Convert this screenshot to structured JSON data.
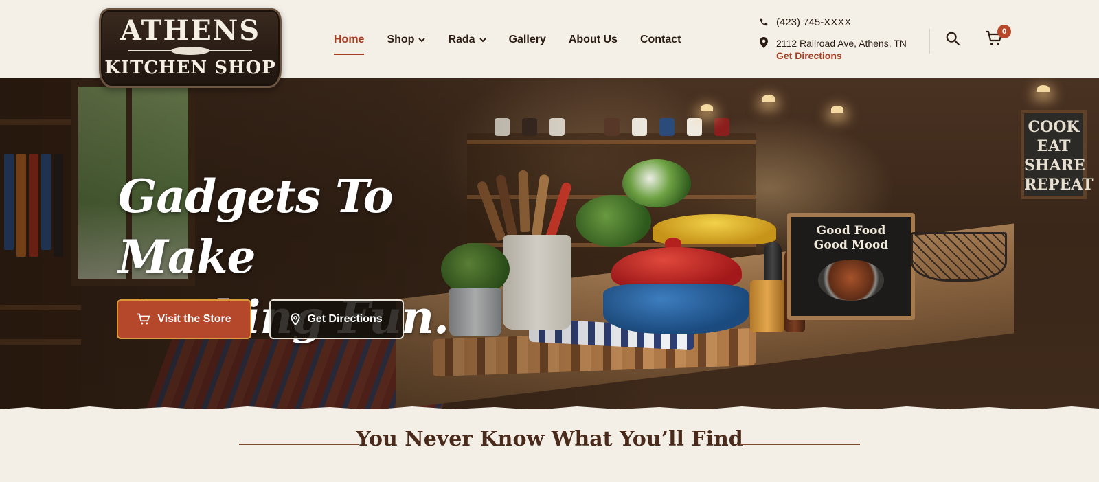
{
  "logo": {
    "line1": "ATHENS",
    "line2": "KITCHEN SHOP"
  },
  "nav": {
    "items": [
      {
        "label": "Home",
        "active": true,
        "has_dropdown": false
      },
      {
        "label": "Shop",
        "active": false,
        "has_dropdown": true
      },
      {
        "label": "Rada",
        "active": false,
        "has_dropdown": true
      },
      {
        "label": "Gallery",
        "active": false,
        "has_dropdown": false
      },
      {
        "label": "About Us",
        "active": false,
        "has_dropdown": false
      },
      {
        "label": "Contact",
        "active": false,
        "has_dropdown": false
      }
    ]
  },
  "contact": {
    "phone": "(423) 745-XXXX",
    "address": "2112 Railroad Ave, Athens, TN",
    "directions_link": "Get Directions"
  },
  "cart": {
    "count": "0"
  },
  "hero": {
    "title_line1": "Gadgets To Make",
    "title_line2": "Cooking Fun.",
    "primary_button": "Visit the Store",
    "secondary_button": "Get Directions",
    "sign_text": [
      "COOK",
      "EAT",
      "SHARE",
      "REPEAT"
    ],
    "book_title": [
      "Good Food",
      "Good Mood"
    ]
  },
  "section": {
    "title": "You Never Know What You’ll Find"
  },
  "colors": {
    "accent": "#a63f22",
    "button_primary": "#b5482b",
    "background": "#f3efe7",
    "text_dark": "#2b1d14"
  },
  "icons": [
    "phone-icon",
    "map-pin-icon",
    "search-icon",
    "cart-icon",
    "chevron-down-icon"
  ]
}
